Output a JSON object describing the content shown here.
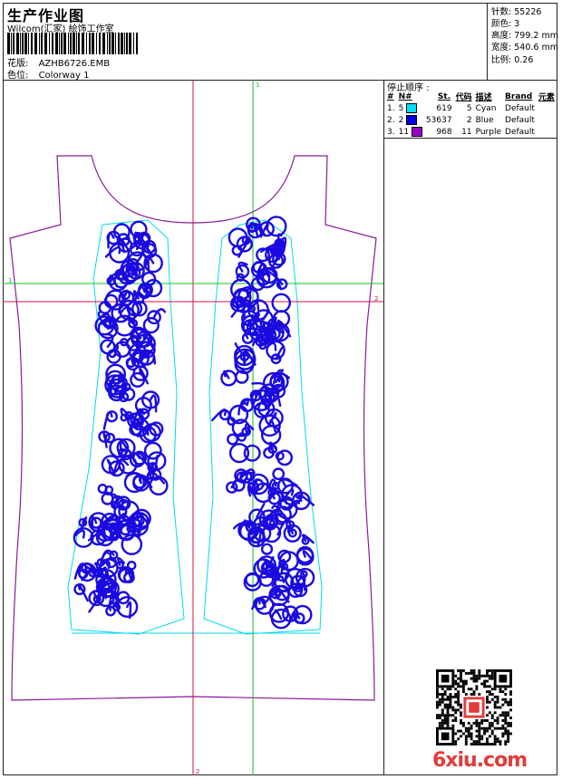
{
  "header": {
    "title": "生产作业图",
    "company": "Wilcom(汇家) 絵饰工作室",
    "design_label": "花版:",
    "design_value": "AZHB6726.EMB",
    "colorway_label": "色位:",
    "colorway_value": "Colorway 1"
  },
  "info": [
    {
      "label": "针数:",
      "value": "55226"
    },
    {
      "label": "颜色:",
      "value": "3"
    },
    {
      "label": "高度:",
      "value": "799.2 mm"
    },
    {
      "label": "宽度:",
      "value": "540.6 mm"
    },
    {
      "label": "比例:",
      "value": "0.26"
    }
  ],
  "stop_sequence": {
    "title": "停止顺序 :",
    "headers": [
      "#",
      "N#",
      "St.",
      "代码",
      "描述",
      "Brand",
      "元素"
    ],
    "rows": [
      {
        "index": "1.",
        "n": "5",
        "color": "#00e0ff",
        "stitches": "619",
        "code": "5",
        "desc": "Cyan",
        "brand": "Default"
      },
      {
        "index": "2.",
        "n": "2",
        "color": "#0000e6",
        "stitches": "53637",
        "code": "2",
        "desc": "Blue",
        "brand": "Default"
      },
      {
        "index": "3.",
        "n": "11",
        "color": "#9b00c8",
        "stitches": "968",
        "code": "11",
        "desc": "Purple",
        "brand": "Default"
      }
    ]
  },
  "canvas": {
    "axis_labels": [
      "1",
      "1",
      "2",
      "2"
    ],
    "colors": {
      "outline": "#8a1a9a",
      "guide": "#00dcec",
      "embroidery": "#1a0ae0",
      "axis_red": "#d01040",
      "axis_green": "#10c020"
    }
  },
  "watermark": "6xiu.com",
  "icons": {
    "qr": "qr-code-icon",
    "barcode": "barcode-icon"
  }
}
